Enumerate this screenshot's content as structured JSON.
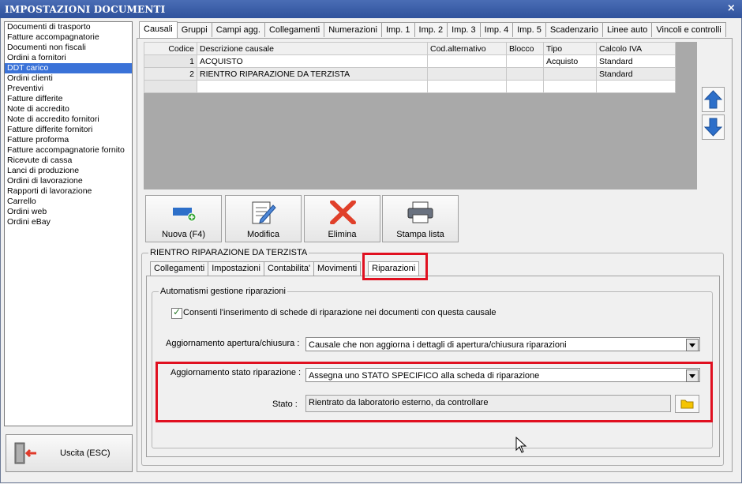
{
  "window": {
    "title": "IMPOSTAZIONI DOCUMENTI",
    "close": "×"
  },
  "doc_types": [
    "Documenti di trasporto",
    "Fatture accompagnatorie",
    "Documenti non fiscali",
    "Ordini a fornitori",
    "DDT carico",
    "Ordini clienti",
    "Preventivi",
    "Fatture differite",
    "Note di accredito",
    "Note di accredito fornitori",
    "Fatture differite fornitori",
    "Fatture proforma",
    "Fatture accompagnatorie fornito",
    "Ricevute di cassa",
    "Lanci di produzione",
    "Ordini di lavorazione",
    "Rapporti di lavorazione",
    "Carrello",
    "Ordini web",
    "Ordini eBay"
  ],
  "exit_label": "Uscita (ESC)",
  "main_tabs": [
    "Causali",
    "Gruppi",
    "Campi agg.",
    "Collegamenti",
    "Numerazioni",
    "Imp. 1",
    "Imp. 2",
    "Imp. 3",
    "Imp. 4",
    "Imp. 5",
    "Scadenzario",
    "Linee auto",
    "Vincoli e controlli"
  ],
  "grid": {
    "headers": [
      "Codice",
      "Descrizione causale",
      "Cod.alternativo",
      "Blocco",
      "Tipo",
      "Calcolo IVA"
    ],
    "rows": [
      [
        "1",
        "ACQUISTO",
        "",
        "",
        "Acquisto",
        "Standard"
      ],
      [
        "2",
        "RIENTRO RIPARAZIONE DA TERZISTA",
        "",
        "",
        "",
        "Standard"
      ],
      [
        "",
        "",
        "",
        "",
        "",
        ""
      ]
    ]
  },
  "toolbar": {
    "new": "Nuova (F4)",
    "edit": "Modifica",
    "delete": "Elimina",
    "print": "Stampa lista"
  },
  "section_title": "RIENTRO RIPARAZIONE DA TERZISTA",
  "sub_tabs": [
    "Collegamenti",
    "Impostazioni",
    "Contabilita'",
    "Movimenti",
    "Riparazioni"
  ],
  "riparazioni": {
    "group_title": "Automatismi gestione riparazioni",
    "checkbox_label": "Consenti l'inserimento di schede di riparazione nei documenti con questa causale",
    "apertura_label": "Aggiornamento apertura/chiusura :",
    "apertura_value": "Causale che non aggiorna i dettagli di apertura/chiusura riparazioni",
    "stato_rip_label": "Aggiornamento stato riparazione :",
    "stato_rip_value": "Assegna uno STATO SPECIFICO alla scheda di riparazione",
    "stato_label": "Stato :",
    "stato_value": "Rientrato da laboratorio esterno, da controllare"
  },
  "colors": {
    "title_bar": "#3b5ea8",
    "selection": "#3a72d8",
    "highlight": "#e01020"
  }
}
